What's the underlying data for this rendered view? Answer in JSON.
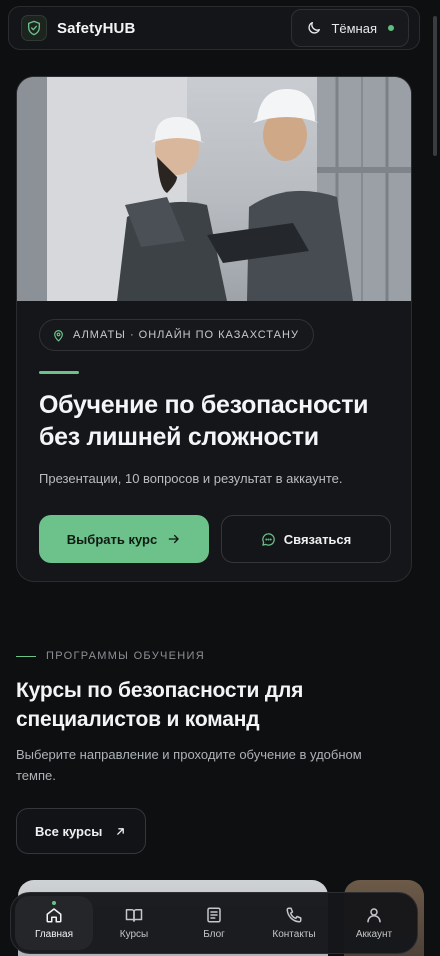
{
  "header": {
    "brand": "SafetyHUB",
    "theme_label": "Тёмная"
  },
  "hero": {
    "location": "АЛМАТЫ · ОНЛАЙН ПО КАЗАХСТАНУ",
    "title_line1": "Обучение по безопасности",
    "title_line2": "без лишней сложности",
    "subtitle": "Презентации, 10 вопросов и результат в аккаунте.",
    "primary_button": "Выбрать курс",
    "secondary_button": "Связаться"
  },
  "programs": {
    "eyebrow": "ПРОГРАММЫ ОБУЧЕНИЯ",
    "title_line1": "Курсы по безопасности для",
    "title_line2": "специалистов и команд",
    "desc_line1": "Выберите направление и проходите обучение в удобном",
    "desc_line2": "темпе.",
    "all_button": "Все курсы"
  },
  "nav": {
    "items": [
      {
        "label": "Главная",
        "icon": "home-icon",
        "active": true
      },
      {
        "label": "Курсы",
        "icon": "book-icon",
        "active": false
      },
      {
        "label": "Блог",
        "icon": "blog-icon",
        "active": false
      },
      {
        "label": "Контакты",
        "icon": "phone-icon",
        "active": false
      },
      {
        "label": "Аккаунт",
        "icon": "user-icon",
        "active": false
      }
    ]
  },
  "colors": {
    "accent": "#6cc28a",
    "background": "#0e0f11",
    "card": "#151619"
  }
}
